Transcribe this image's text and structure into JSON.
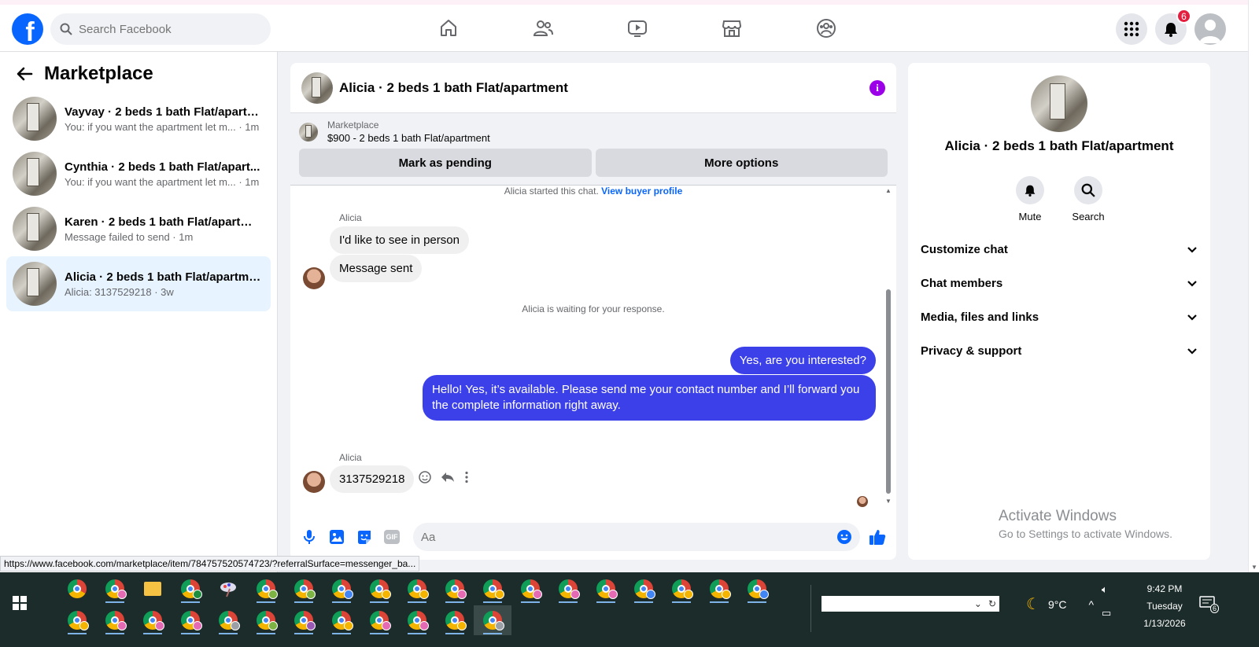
{
  "topbar": {
    "search_placeholder": "Search Facebook",
    "notification_count": "6"
  },
  "left": {
    "title": "Marketplace",
    "conversations": [
      {
        "title": "Vayvay · 2 beds 1 bath Flat/apartm...",
        "sub": "You: if you want the apartment let m... · 1m"
      },
      {
        "title": "Cynthia · 2 beds 1 bath Flat/apart...",
        "sub": "You: if you want the apartment let m... · 1m"
      },
      {
        "title": "Karen · 2 beds 1 bath Flat/apartment",
        "sub": "Message failed to send · 1m"
      },
      {
        "title": "Alicia · 2 beds 1 bath Flat/apartment",
        "sub": "Alicia: 3137529218 · 3w"
      }
    ]
  },
  "chat": {
    "title": "Alicia · 2 beds 1 bath Flat/apartment",
    "listing_source": "Marketplace",
    "listing_price": "$900 - 2 beds 1 bath Flat/apartment",
    "mark_pending": "Mark as pending",
    "more_options": "More options",
    "started_text": "Alicia started this chat.",
    "view_profile": "View buyer profile",
    "sender1": "Alicia",
    "msg1": "I'd like to see in person",
    "msg2": "Message sent",
    "waiting": "Alicia is waiting for your response.",
    "out1": "Yes, are you interested?",
    "out2": "Hello! Yes, it’s available. Please send me your contact number and I’ll forward you the complete information right away.",
    "sender2": "Alicia",
    "msg3": "3137529218",
    "composer_placeholder": "Aa",
    "gif_label": "GIF"
  },
  "right": {
    "name": "Alicia · 2 beds 1 bath Flat/apartment",
    "mute": "Mute",
    "search": "Search",
    "sections": [
      "Customize chat",
      "Chat members",
      "Media, files and links",
      "Privacy & support"
    ]
  },
  "watermark": {
    "line1": "Activate Windows",
    "line2": "Go to Settings to activate Windows."
  },
  "status_url": "https://www.facebook.com/marketplace/item/784757520574723/?referralSurface=messenger_ba...",
  "taskbar": {
    "temperature": "9°C",
    "time": "9:42 PM",
    "day": "Tuesday",
    "date": "1/13/2026",
    "notif_count": "6"
  }
}
